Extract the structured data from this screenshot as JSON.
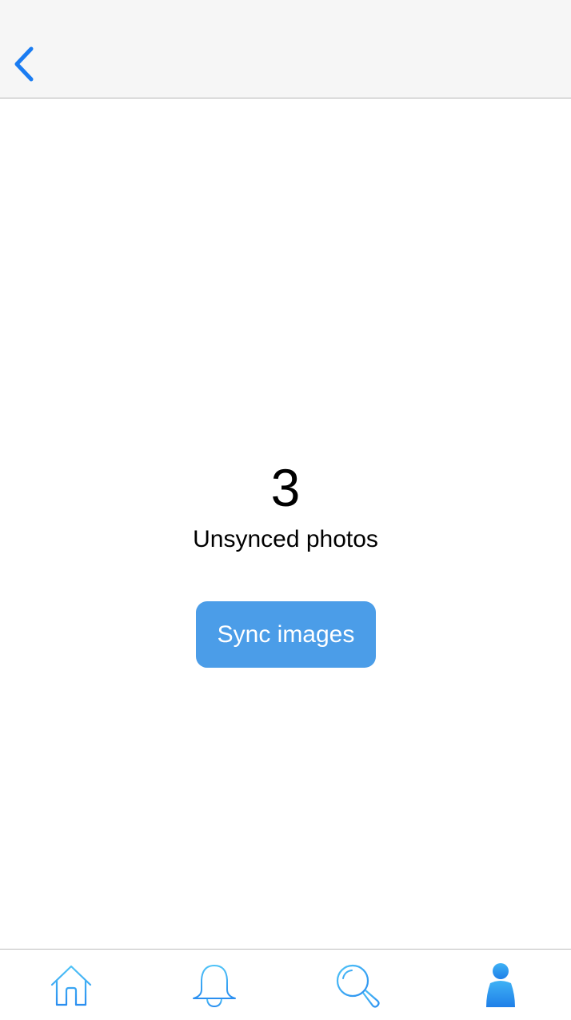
{
  "nav": {
    "back_icon": "chevron-left-icon",
    "accent_color": "#1a7cf2"
  },
  "main": {
    "count": "3",
    "count_label": "Unsynced photos",
    "sync_button_label": "Sync images",
    "button_color": "#4b9de8"
  },
  "tab_bar": {
    "tabs": [
      {
        "icon": "home-icon",
        "active": false
      },
      {
        "icon": "bell-icon",
        "active": false
      },
      {
        "icon": "search-icon",
        "active": false
      },
      {
        "icon": "profile-icon",
        "active": true
      }
    ],
    "icon_color": "#3fa2f0"
  }
}
